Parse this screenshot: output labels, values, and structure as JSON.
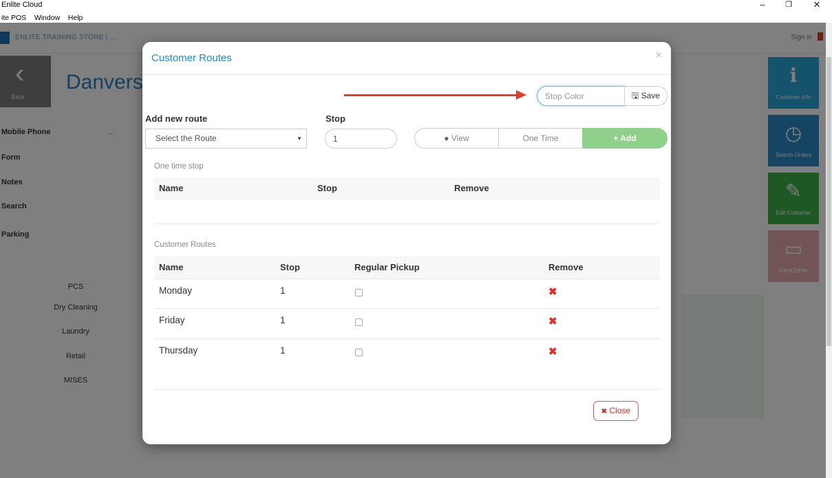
{
  "window": {
    "title": "Enlite Cloud",
    "menu": [
      "ite POS",
      "Window",
      "Help"
    ],
    "controls": [
      "–",
      "❐",
      "✕"
    ]
  },
  "background": {
    "breadcrumb": "ENLITE TRAINING STORE | ...",
    "signout": "Sign in",
    "back_label": "Back",
    "store_name": "Danvers",
    "fields": [
      {
        "label": "Mobile Phone",
        "value": "..."
      },
      {
        "label": "Form",
        "value": ""
      },
      {
        "label": "Notes",
        "value": ""
      },
      {
        "label": "Search",
        "value": ""
      },
      {
        "label": "Parking",
        "value": ""
      }
    ],
    "services": [
      "PCS",
      "Dry Cleaning",
      "Laundry",
      "Retail",
      "MISES"
    ],
    "tiles": [
      {
        "icon": "ℹ",
        "label": "Customer Info",
        "color": "#2aa4d6"
      },
      {
        "icon": "◷",
        "label": "Search Orders",
        "color": "#2d8ac7"
      },
      {
        "icon": "✎",
        "label": "Edit Customer",
        "color": "#3fae4a"
      },
      {
        "icon": "▭",
        "label": "CardOnFile",
        "color": "#e7a9ad"
      }
    ]
  },
  "modal": {
    "title": "Customer Routes",
    "close_x": "×",
    "stop_color_placeholder": "Stop Color",
    "save_label": "Save",
    "add_route_label": "Add new route",
    "stop_label": "Stop",
    "route_select_value": "Select the Route",
    "stop_value": "1",
    "view_label": "View",
    "one_time_label": "One Time",
    "add_label": "Add",
    "one_time_section": {
      "title": "One time stop",
      "columns": [
        "Name",
        "Stop",
        "Remove"
      ]
    },
    "routes_section": {
      "title": "Customer Routes",
      "columns": [
        "Name",
        "Stop",
        "Regular Pickup",
        "Remove"
      ],
      "rows": [
        {
          "name": "Monday",
          "stop": "1",
          "regular_pickup": false
        },
        {
          "name": "Friday",
          "stop": "1",
          "regular_pickup": false
        },
        {
          "name": "Thursday",
          "stop": "1",
          "regular_pickup": false
        }
      ]
    },
    "close_label": "Close",
    "accent_color": "#1d8acc",
    "add_color": "#8fd08a",
    "remove_color": "#d9302f"
  }
}
